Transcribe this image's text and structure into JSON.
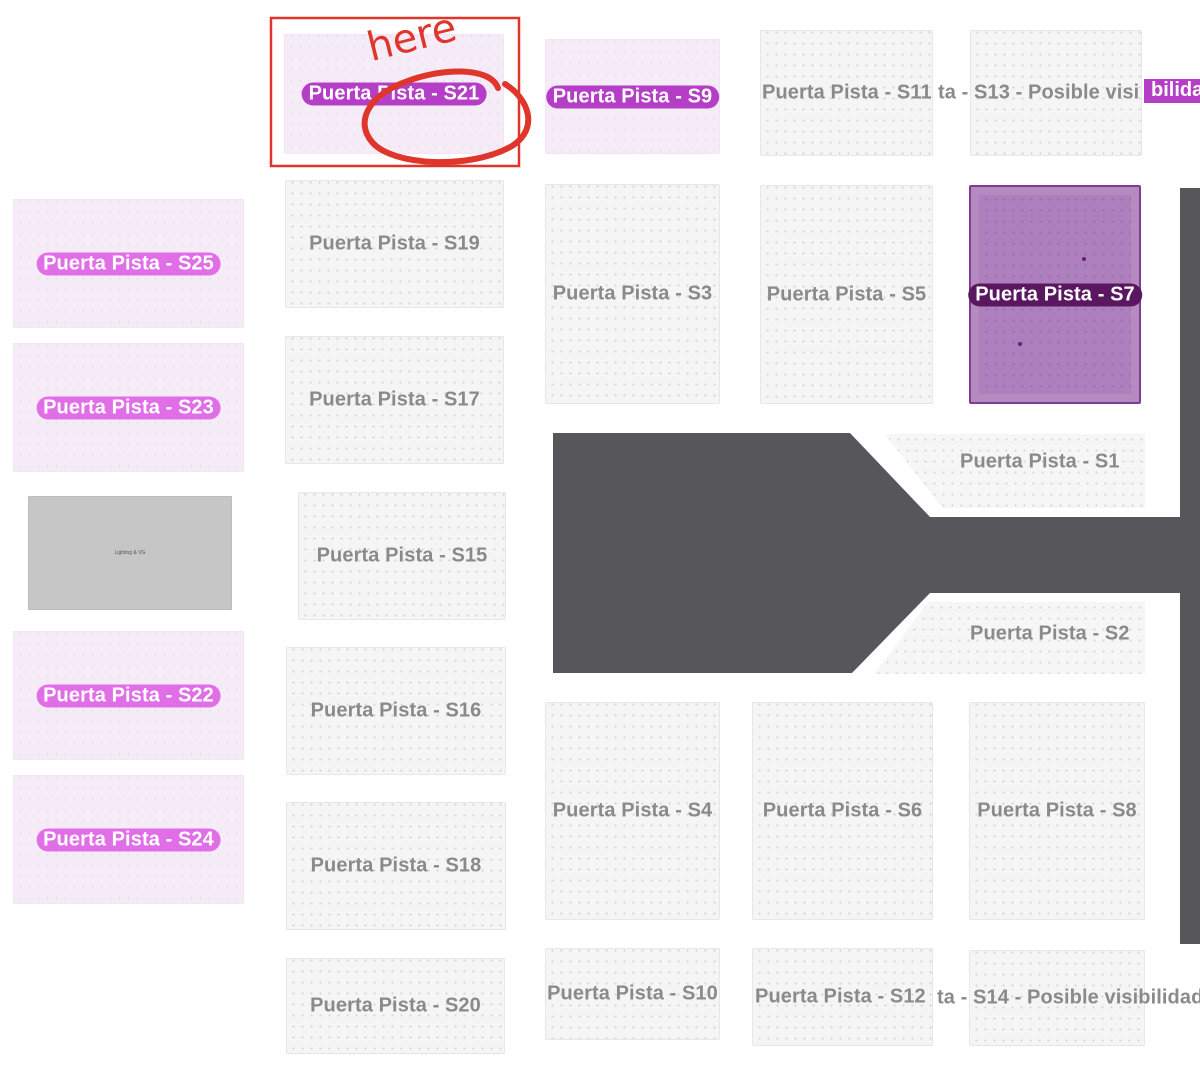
{
  "sections": {
    "s21": "Puerta Pista - S21",
    "s9": "Puerta Pista - S9",
    "s11": "Puerta Pista - S11",
    "s13": "ta - S13 - Posible visi",
    "s13_cut": "bilidad",
    "s25": "Puerta Pista - S25",
    "s19": "Puerta Pista - S19",
    "s3": "Puerta Pista - S3",
    "s5": "Puerta Pista - S5",
    "s7": "Puerta Pista - S7",
    "s23": "Puerta Pista - S23",
    "s17": "Puerta Pista - S17",
    "s1": "Puerta Pista - S1",
    "s15": "Puerta Pista - S15",
    "s2": "Puerta Pista - S2",
    "s22": "Puerta Pista - S22",
    "s16": "Puerta Pista - S16",
    "s4": "Puerta Pista - S4",
    "s6": "Puerta Pista - S6",
    "s8": "Puerta Pista - S8",
    "s24": "Puerta Pista - S24",
    "s18": "Puerta Pista - S18",
    "s20": "Puerta Pista - S20",
    "s10": "Puerta Pista - S10",
    "s12": "Puerta Pista - S12",
    "s14": "ta - S14 - Posible visibilidad"
  },
  "lighting_label": "Lighting & VG",
  "annotation_text": "here",
  "colors": {
    "available": "#e06ee6",
    "available_strong": "#b43fc6",
    "selected": "#5a175f",
    "stage": "#57575b",
    "annotation": "#e0352b"
  }
}
